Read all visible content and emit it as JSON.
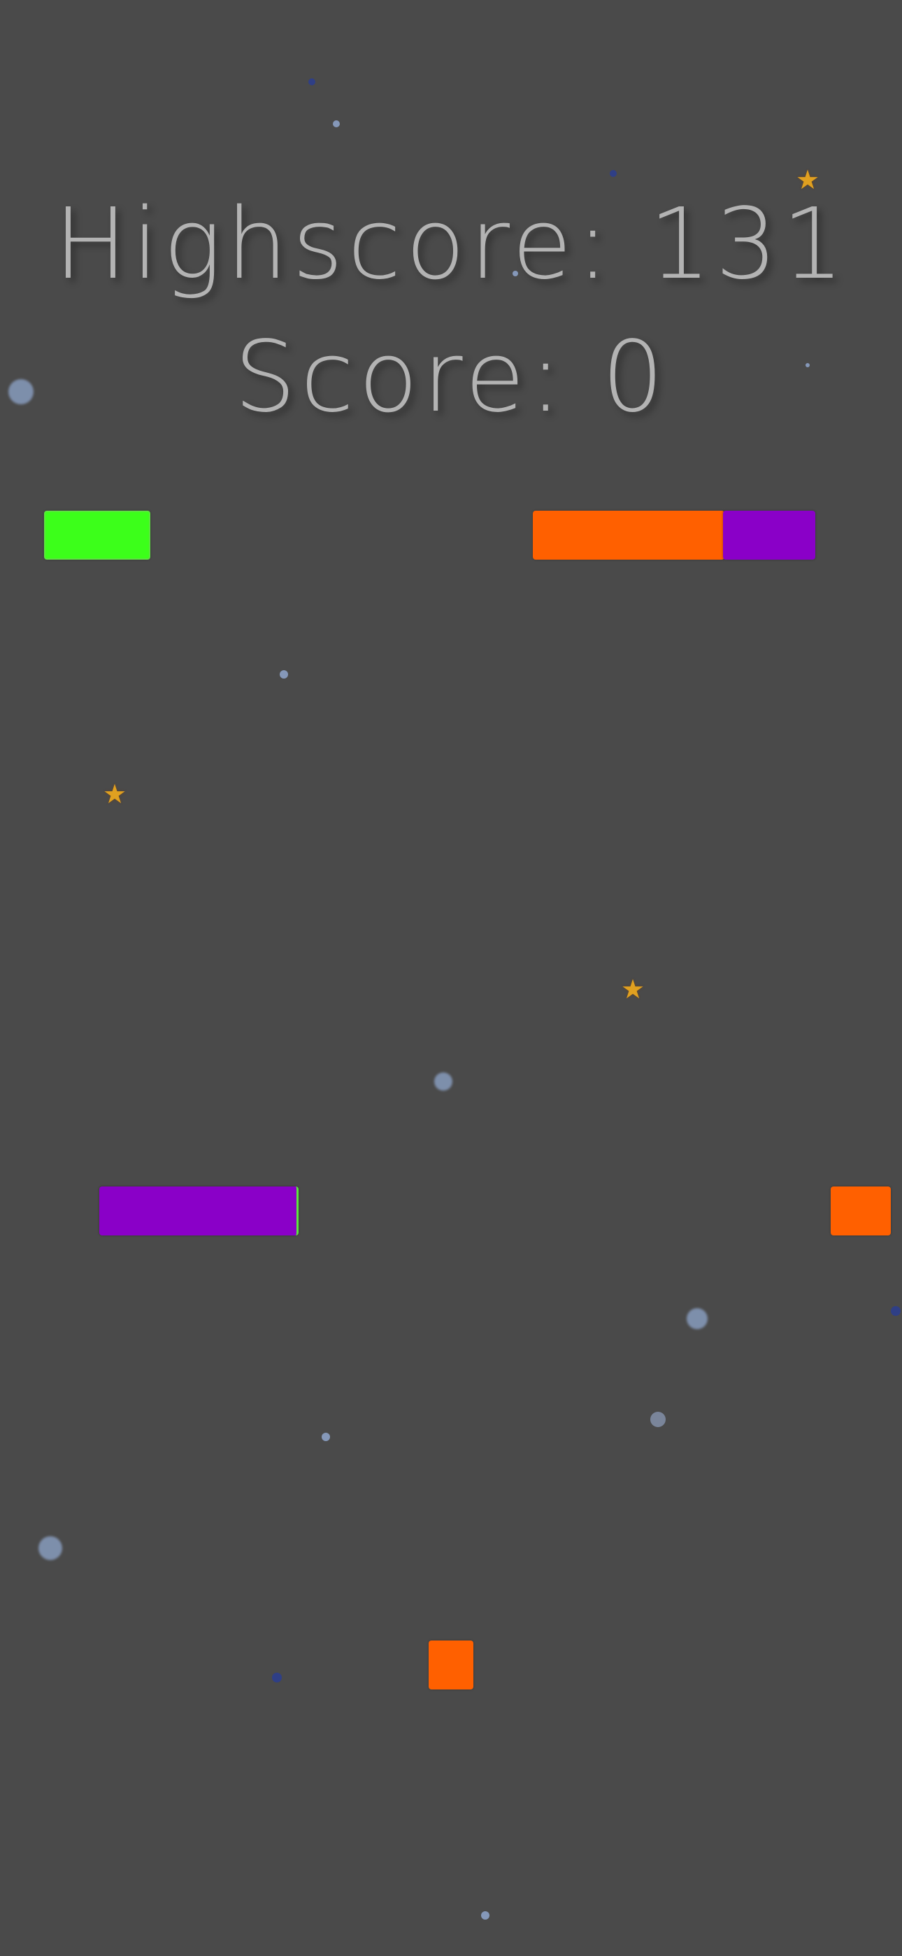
{
  "hud": {
    "highscore_text": "Highscore: 131",
    "score_text": "Score: 0"
  },
  "colors": {
    "background": "#4a4a4a",
    "text": "#b3b3b3",
    "green_block": "#3cff1a",
    "orange_block": "#ff6000",
    "purple_block": "#8a00c8",
    "star": "#e0a020",
    "particle_light": "#8fa6cc",
    "particle_dark": "#2f3f86"
  },
  "icons": {
    "star": "★"
  }
}
